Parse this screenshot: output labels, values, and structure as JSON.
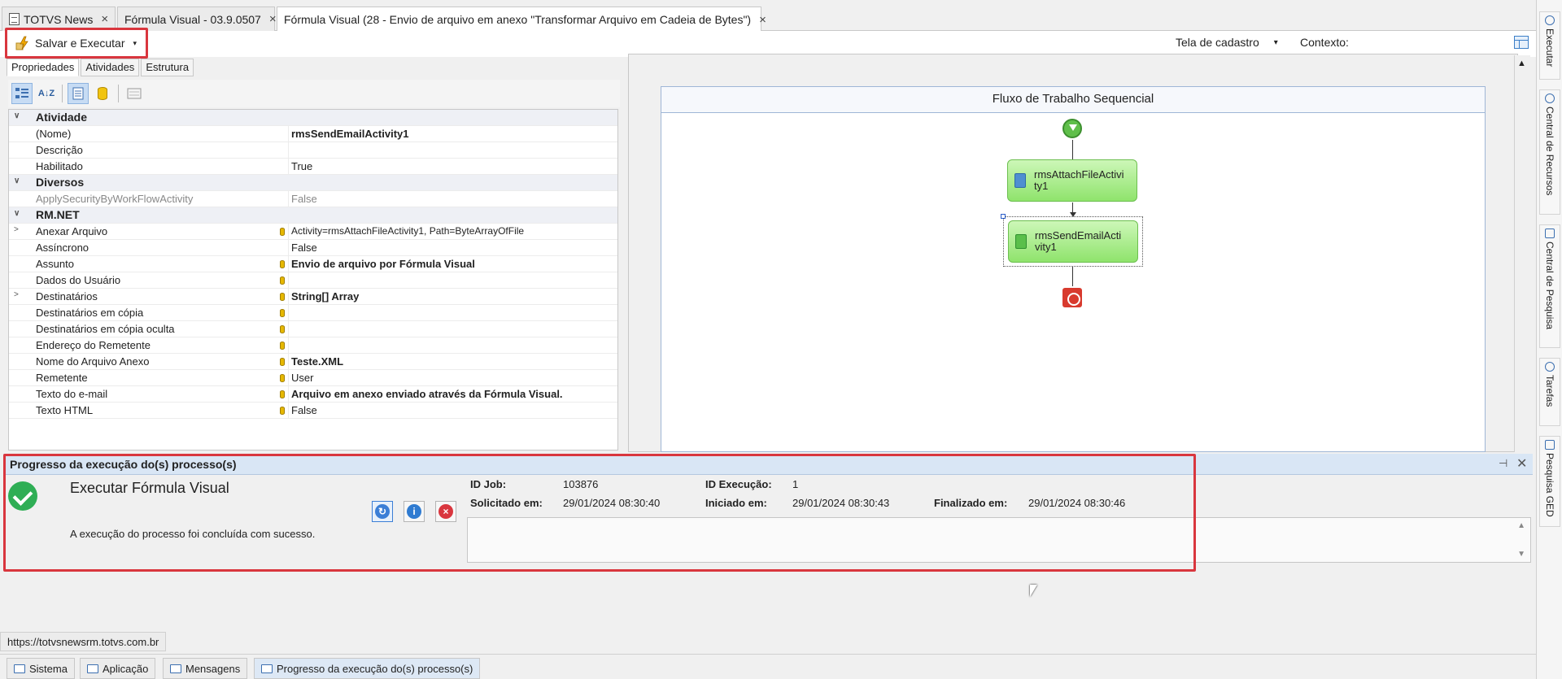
{
  "tabs": [
    {
      "label": "TOTVS News",
      "close": "×"
    },
    {
      "label": "Fórmula Visual - 03.9.0507",
      "close": "×"
    },
    {
      "label": "Fórmula Visual (28 - Envio de arquivo em anexo \"Transformar Arquivo em Cadeia de Bytes\")",
      "close": "×"
    }
  ],
  "toolbar": {
    "run_label": "Salvar e Executar",
    "caret": "▾",
    "tela": "Tela de cadastro",
    "tela_caret": "▾",
    "contexto": "Contexto:"
  },
  "left": {
    "tabs": [
      "Propriedades",
      "Atividades",
      "Estrutura"
    ],
    "sort_alpha": "A↓Z"
  },
  "properties": [
    {
      "type": "cat",
      "exp": "∨",
      "name": "Atividade"
    },
    {
      "name": "(Nome)",
      "value": "rmsSendEmailActivity1",
      "bold": true
    },
    {
      "name": "Descrição",
      "value": ""
    },
    {
      "name": "Habilitado",
      "value": "True"
    },
    {
      "type": "cat",
      "exp": "∨",
      "name": "Diversos"
    },
    {
      "name": "ApplySecurityByWorkFlowActivity",
      "value": "False",
      "grey": true
    },
    {
      "type": "cat",
      "exp": "∨",
      "name": "RM.NET"
    },
    {
      "name": "Anexar Arquivo",
      "exp": ">",
      "value": "Activity=rmsAttachFileActivity1, Path=ByteArrayOfFile",
      "dot": true,
      "small": true
    },
    {
      "name": "Assíncrono",
      "value": "False"
    },
    {
      "name": "Assunto",
      "value": "Envio de arquivo por Fórmula Visual",
      "dot": true,
      "bold": true
    },
    {
      "name": "Dados do Usuário",
      "value": "",
      "dot": true
    },
    {
      "name": "Destinatários",
      "exp": ">",
      "value": "String[] Array",
      "dot": true,
      "bold": true
    },
    {
      "name": "Destinatários em cópia",
      "value": "",
      "dot": true
    },
    {
      "name": "Destinatários em cópia oculta",
      "value": "",
      "dot": true
    },
    {
      "name": "Endereço do Remetente",
      "value": "",
      "dot": true
    },
    {
      "name": "Nome do Arquivo Anexo",
      "value": "Teste.XML",
      "dot": true,
      "bold": true
    },
    {
      "name": "Remetente",
      "value": "User",
      "dot": true
    },
    {
      "name": "Texto do e-mail",
      "value": "Arquivo em anexo enviado através da Fórmula Visual.",
      "dot": true,
      "bold": true
    },
    {
      "name": "Texto HTML",
      "value": "False",
      "dot": true
    }
  ],
  "designer": {
    "title": "Fluxo de Trabalho Sequencial",
    "activities": [
      {
        "line1": "rmsAttachFileActivi",
        "line2": "ty1"
      },
      {
        "line1": "rmsSendEmailActi",
        "line2": "vity1"
      }
    ]
  },
  "progress": {
    "title": "Progresso da execução do(s) processo(s)",
    "pin": "⊣",
    "close": "✕",
    "process_name": "Executar Fórmula Visual",
    "message": "A execução do processo foi concluída com sucesso.",
    "id_job_label": "ID Job:",
    "id_job": "103876",
    "id_exec_label": "ID Execução:",
    "id_exec": "1",
    "solicitado_label": "Solicitado em:",
    "solicitado": "29/01/2024 08:30:40",
    "iniciado_label": "Iniciado em:",
    "iniciado": "29/01/2024 08:30:43",
    "finalizado_label": "Finalizado em:",
    "finalizado": "29/01/2024 08:30:46",
    "btn_refresh": "↻",
    "btn_info": "i",
    "btn_cancel": "×"
  },
  "status_url": "https://totvsnewsrm.totvs.com.br",
  "bottom_tabs": [
    "Sistema",
    "Aplicação",
    "Mensagens",
    "Progresso da execução do(s) processo(s)"
  ],
  "right_dock": [
    "Executar",
    "Central de Recursos",
    "Central de Pesquisa",
    "Tarefas",
    "Pesquisa GED"
  ],
  "colors": {
    "highlight_red": "#d9363e",
    "activity_green": "#8fe36c",
    "success": "#2fae55"
  }
}
